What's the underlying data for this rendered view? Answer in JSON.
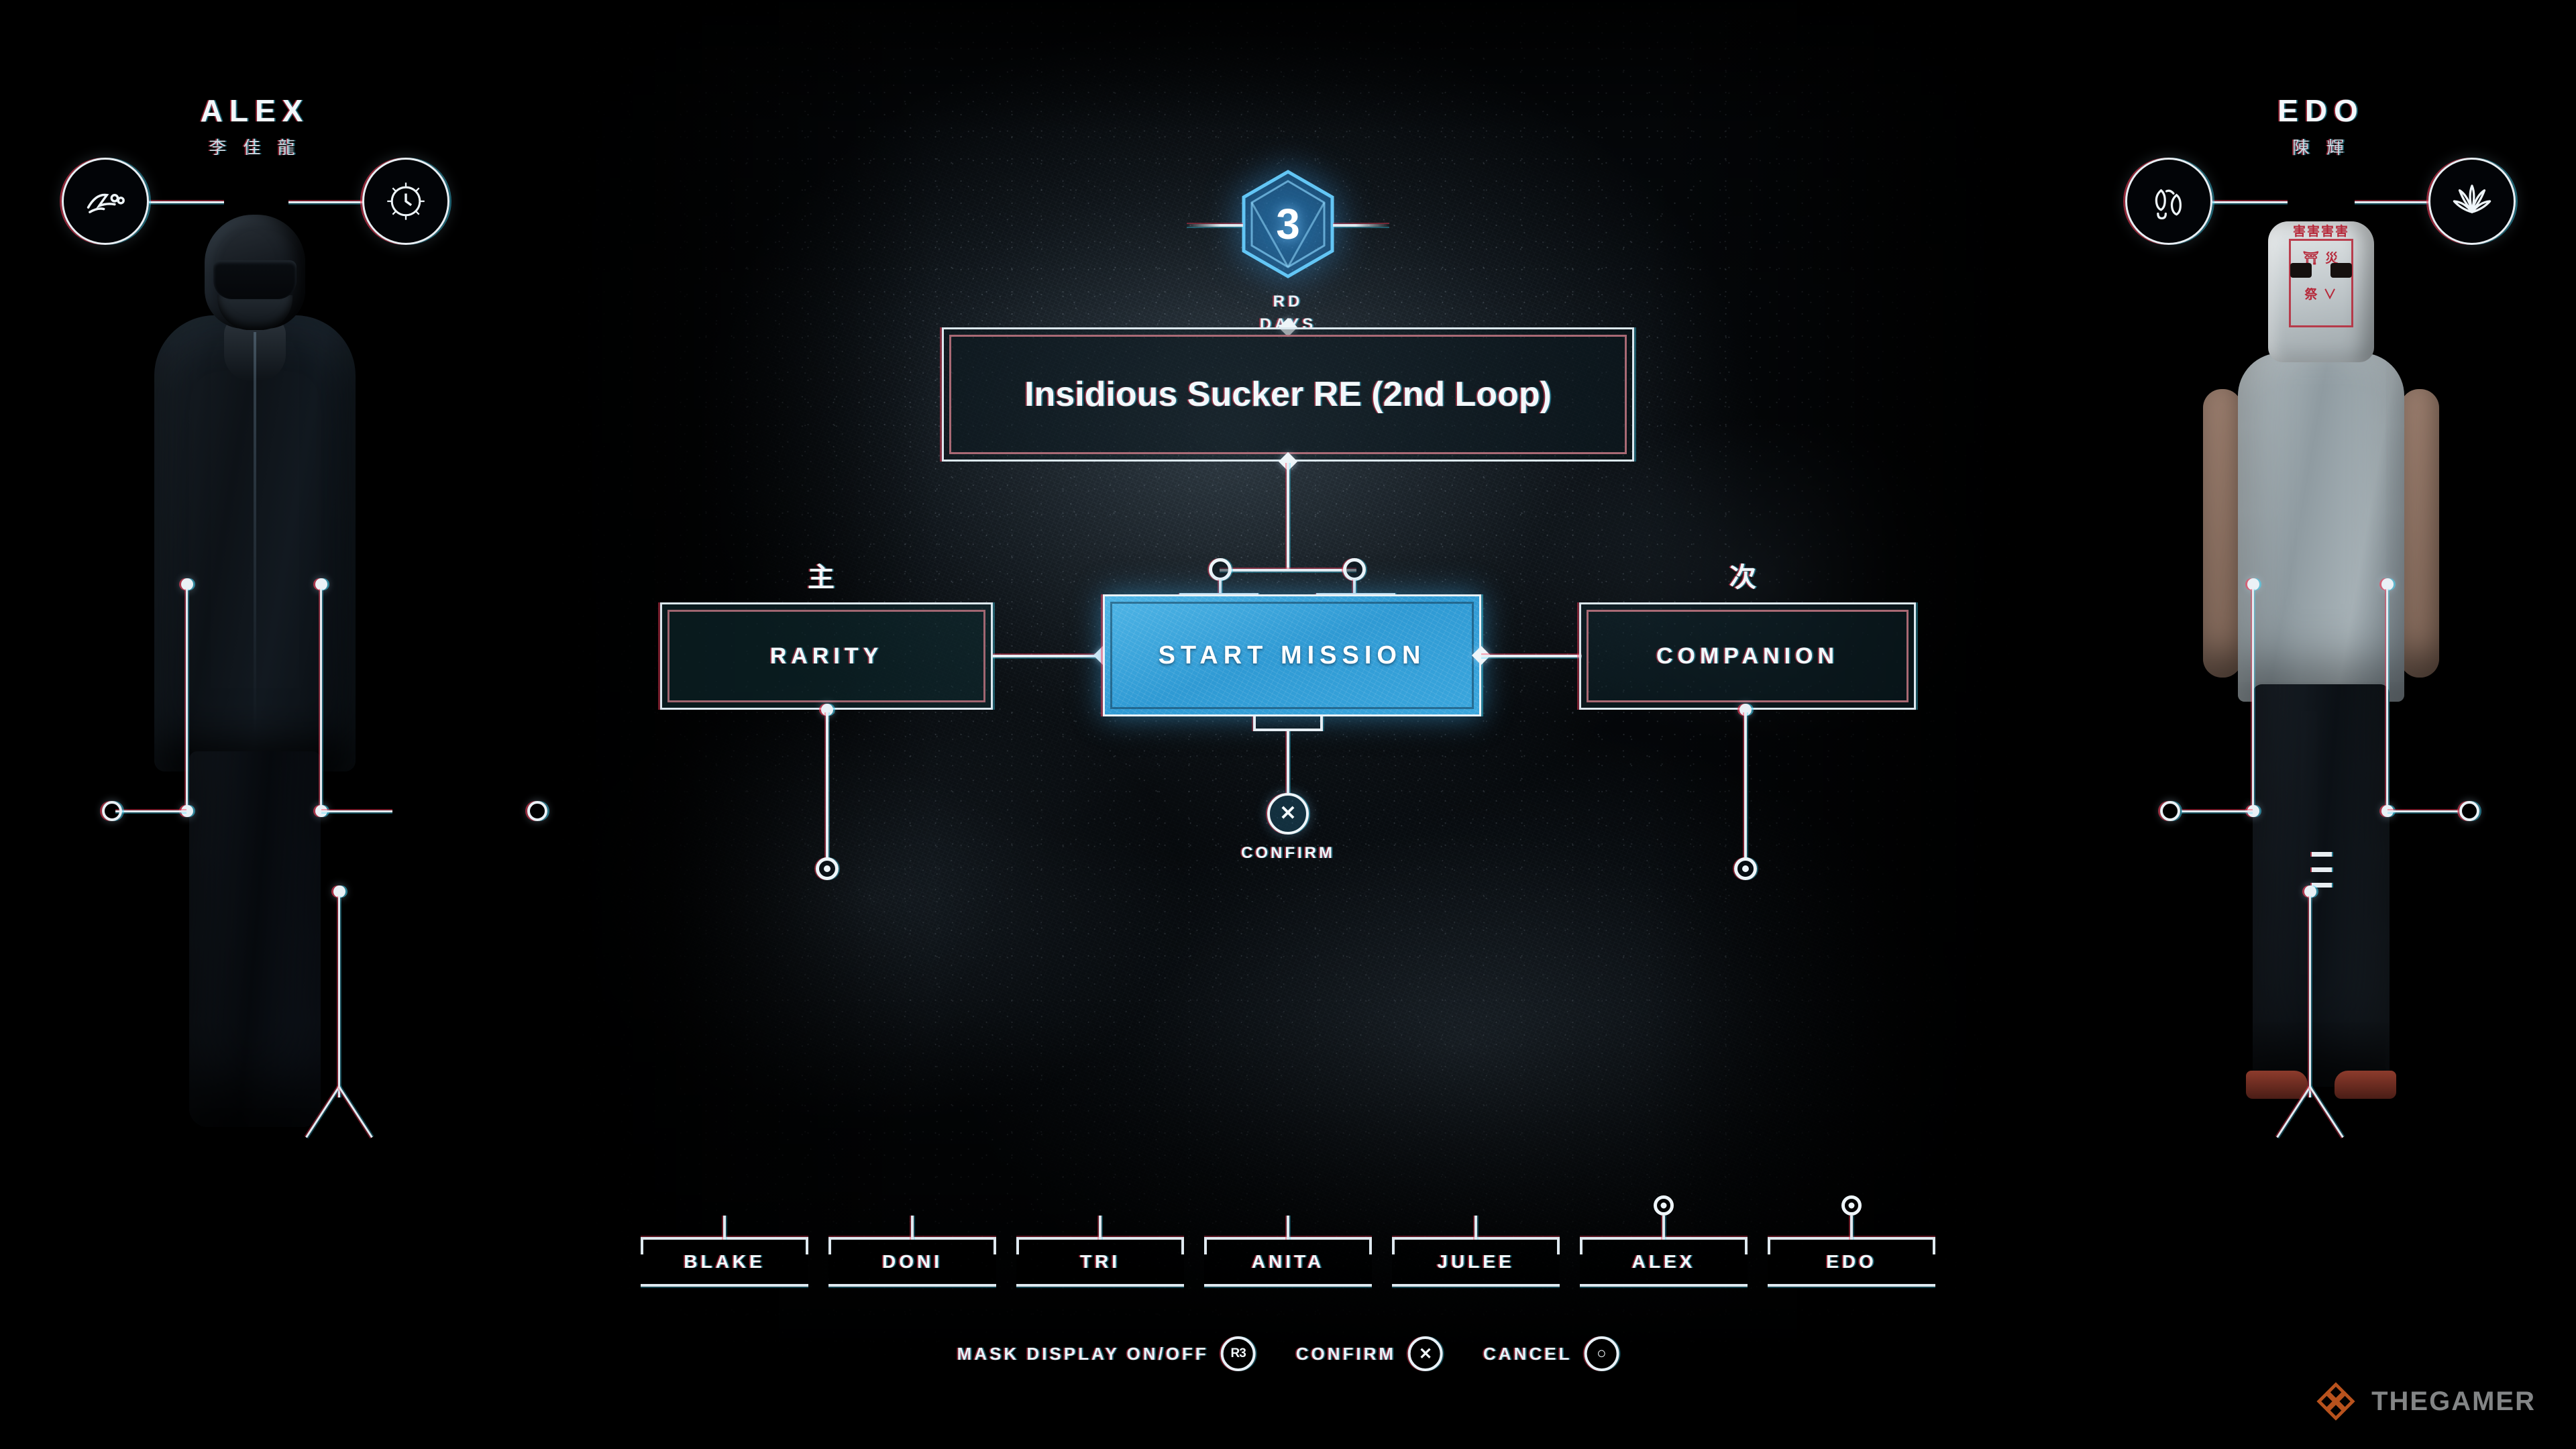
{
  "day_badge": {
    "number": "3",
    "ordinal": "RD",
    "unit": "DAYS"
  },
  "mission": {
    "title": "Insidious Sucker RE (2nd Loop)"
  },
  "graph": {
    "rarity_label": "RARITY",
    "start_mission_label": "START MISSION",
    "companion_label": "COMPANION",
    "kanji_primary": "主",
    "kanji_secondary": "次",
    "confirm_caption": "CONFIRM",
    "confirm_glyph": "✕"
  },
  "characters": {
    "left": {
      "name": "ALEX",
      "native_name": "李 佳 龍"
    },
    "right": {
      "name": "EDO",
      "native_name": "陳 輝"
    }
  },
  "edo_mask": {
    "line1": "害害害害",
    "line2": "⛩ 災",
    "line3": "祭 ∨"
  },
  "character_tabs": [
    {
      "label": "BLAKE",
      "selected": false
    },
    {
      "label": "DONI",
      "selected": false
    },
    {
      "label": "TRI",
      "selected": false
    },
    {
      "label": "ANITA",
      "selected": false
    },
    {
      "label": "JULEE",
      "selected": false
    },
    {
      "label": "ALEX",
      "selected": true
    },
    {
      "label": "EDO",
      "selected": true
    }
  ],
  "footer_hints": [
    {
      "label": "MASK DISPLAY ON/OFF",
      "button": "R3"
    },
    {
      "label": "CONFIRM",
      "button": "✕"
    },
    {
      "label": "CANCEL",
      "button": "○"
    }
  ],
  "watermark": {
    "text": "THEGAMER"
  },
  "colors": {
    "hud_white": "#e9f1f7",
    "chroma_red": "#ff3c5a",
    "chroma_cyan": "#3cdcff",
    "highlight_blue": "#3aa6dd",
    "panel_teal": "#102c32",
    "watermark_orange": "#c2571f",
    "watermark_grey": "#8b8d8e"
  }
}
